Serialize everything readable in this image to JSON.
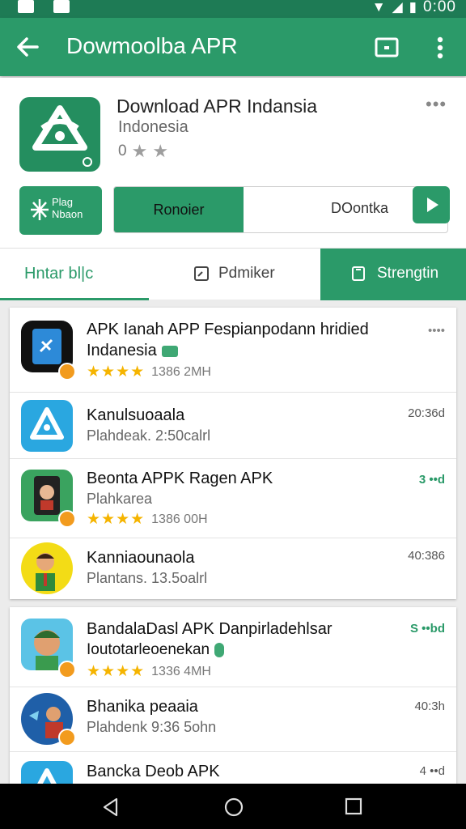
{
  "status_bar": {
    "time": "0:00"
  },
  "app_bar": {
    "title": "Dowmoolba APR"
  },
  "app": {
    "title": "Download APR Indansia",
    "subtitle": "Indonesia",
    "rating_text": "0",
    "plus_label_line1": "Plag",
    "plus_label_line2": "Nbaon",
    "segment_left": "Ronoier",
    "segment_right": "DOontka"
  },
  "tabs": [
    {
      "label": "Hntar bl|c"
    },
    {
      "label": "Pdmiker"
    },
    {
      "label": "Strengtin"
    }
  ],
  "list1": [
    {
      "title_line1": "APK Ianah APP Fespianpodann hridied",
      "title_line2": "Indanesia",
      "stars": "★★★★",
      "meta": "1386 2MH",
      "right": "••••"
    },
    {
      "title": "Kanulsuoaala",
      "subtitle": "Plahdeak. 2:50calrl",
      "right": "20:36d"
    },
    {
      "title": "Beonta APPK Ragen APK",
      "subtitle": "Plahkarea",
      "stars": "★★★★",
      "meta": "1386 00H",
      "right": "3 ••d"
    },
    {
      "title": "Kanniaounaola",
      "subtitle": "Plantans. 13.5oalrl",
      "right": "40:386"
    }
  ],
  "list2": [
    {
      "title": "BandalaDasl APK Danpirladehlsar",
      "subtitle": "Ioutotarleoenekan",
      "stars": "★★★★",
      "meta": "1336 4MH",
      "right": "S ••bd"
    },
    {
      "title": "Bhanika peaaia",
      "subtitle": "Plahdenk 9:36 5ohn",
      "right": "40:3h"
    },
    {
      "title": "Bancka Deob APK",
      "right": "4 ••d"
    }
  ],
  "colors": {
    "primary": "#2b9a69",
    "primary_dark": "#1e7b55",
    "star": "#f5b400",
    "badge": "#f29b1e"
  }
}
